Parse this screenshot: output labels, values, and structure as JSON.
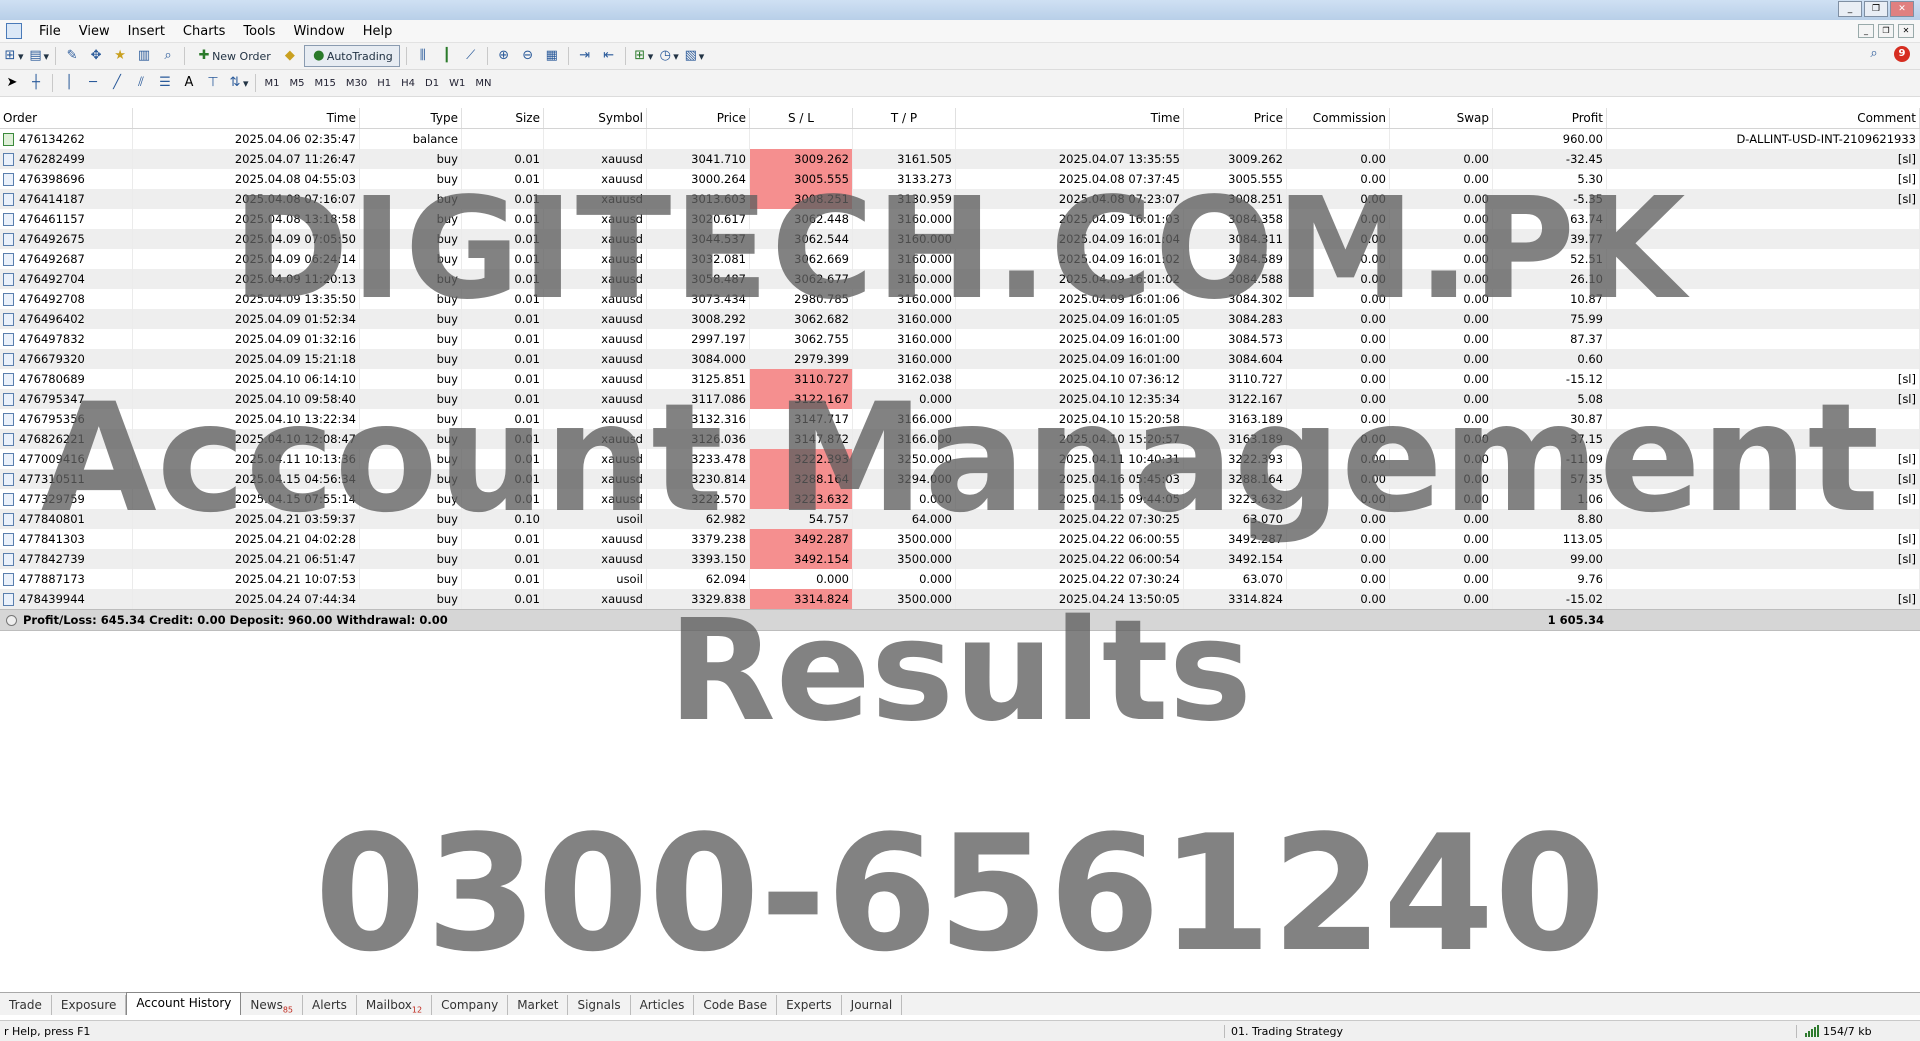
{
  "menu": [
    "File",
    "View",
    "Insert",
    "Charts",
    "Tools",
    "Window",
    "Help"
  ],
  "toolbar": {
    "new_order": "New Order",
    "autotrading": "AutoTrading",
    "notification_count": "9"
  },
  "timeframes": [
    "M1",
    "M5",
    "M15",
    "M30",
    "H1",
    "H4",
    "D1",
    "W1",
    "MN"
  ],
  "columns": {
    "order": "Order",
    "time": "Time",
    "type": "Type",
    "size": "Size",
    "symbol": "Symbol",
    "price": "Price",
    "sl": "S / L",
    "tp": "T / P",
    "close_time": "Time",
    "close_price": "Price",
    "commission": "Commission",
    "swap": "Swap",
    "profit": "Profit",
    "comment": "Comment"
  },
  "rows": [
    {
      "order": "476134262",
      "time": "2025.04.06 02:35:47",
      "type": "balance",
      "size": "",
      "symbol": "",
      "price": "",
      "sl": "",
      "tp": "",
      "close_time": "",
      "close_price": "",
      "commission": "",
      "swap": "",
      "profit": "960.00",
      "comment": "D-ALLINT-USD-INT-2109621933",
      "sl_hit": false
    },
    {
      "order": "476282499",
      "time": "2025.04.07 11:26:47",
      "type": "buy",
      "size": "0.01",
      "symbol": "xauusd",
      "price": "3041.710",
      "sl": "3009.262",
      "tp": "3161.505",
      "close_time": "2025.04.07 13:35:55",
      "close_price": "3009.262",
      "commission": "0.00",
      "swap": "0.00",
      "profit": "-32.45",
      "comment": "[sl]",
      "sl_hit": true
    },
    {
      "order": "476398696",
      "time": "2025.04.08 04:55:03",
      "type": "buy",
      "size": "0.01",
      "symbol": "xauusd",
      "price": "3000.264",
      "sl": "3005.555",
      "tp": "3133.273",
      "close_time": "2025.04.08 07:37:45",
      "close_price": "3005.555",
      "commission": "0.00",
      "swap": "0.00",
      "profit": "5.30",
      "comment": "[sl]",
      "sl_hit": true
    },
    {
      "order": "476414187",
      "time": "2025.04.08 07:16:07",
      "type": "buy",
      "size": "0.01",
      "symbol": "xauusd",
      "price": "3013.603",
      "sl": "3008.251",
      "tp": "3130.959",
      "close_time": "2025.04.08 07:23:07",
      "close_price": "3008.251",
      "commission": "0.00",
      "swap": "0.00",
      "profit": "-5.35",
      "comment": "[sl]",
      "sl_hit": true
    },
    {
      "order": "476461157",
      "time": "2025.04.08 13:18:58",
      "type": "buy",
      "size": "0.01",
      "symbol": "xauusd",
      "price": "3020.617",
      "sl": "3062.448",
      "tp": "3160.000",
      "close_time": "2025.04.09 16:01:03",
      "close_price": "3084.358",
      "commission": "0.00",
      "swap": "0.00",
      "profit": "63.74",
      "comment": "",
      "sl_hit": false
    },
    {
      "order": "476492675",
      "time": "2025.04.09 07:05:50",
      "type": "buy",
      "size": "0.01",
      "symbol": "xauusd",
      "price": "3044.537",
      "sl": "3062.544",
      "tp": "3160.000",
      "close_time": "2025.04.09 16:01:04",
      "close_price": "3084.311",
      "commission": "0.00",
      "swap": "0.00",
      "profit": "39.77",
      "comment": "",
      "sl_hit": false
    },
    {
      "order": "476492687",
      "time": "2025.04.09 06:24:14",
      "type": "buy",
      "size": "0.01",
      "symbol": "xauusd",
      "price": "3032.081",
      "sl": "3062.669",
      "tp": "3160.000",
      "close_time": "2025.04.09 16:01:02",
      "close_price": "3084.589",
      "commission": "0.00",
      "swap": "0.00",
      "profit": "52.51",
      "comment": "",
      "sl_hit": false
    },
    {
      "order": "476492704",
      "time": "2025.04.09 11:20:13",
      "type": "buy",
      "size": "0.01",
      "symbol": "xauusd",
      "price": "3058.487",
      "sl": "3062.677",
      "tp": "3160.000",
      "close_time": "2025.04.09 16:01:02",
      "close_price": "3084.588",
      "commission": "0.00",
      "swap": "0.00",
      "profit": "26.10",
      "comment": "",
      "sl_hit": false
    },
    {
      "order": "476492708",
      "time": "2025.04.09 13:35:50",
      "type": "buy",
      "size": "0.01",
      "symbol": "xauusd",
      "price": "3073.434",
      "sl": "2980.785",
      "tp": "3160.000",
      "close_time": "2025.04.09 16:01:06",
      "close_price": "3084.302",
      "commission": "0.00",
      "swap": "0.00",
      "profit": "10.87",
      "comment": "",
      "sl_hit": false
    },
    {
      "order": "476496402",
      "time": "2025.04.09 01:52:34",
      "type": "buy",
      "size": "0.01",
      "symbol": "xauusd",
      "price": "3008.292",
      "sl": "3062.682",
      "tp": "3160.000",
      "close_time": "2025.04.09 16:01:05",
      "close_price": "3084.283",
      "commission": "0.00",
      "swap": "0.00",
      "profit": "75.99",
      "comment": "",
      "sl_hit": false
    },
    {
      "order": "476497832",
      "time": "2025.04.09 01:32:16",
      "type": "buy",
      "size": "0.01",
      "symbol": "xauusd",
      "price": "2997.197",
      "sl": "3062.755",
      "tp": "3160.000",
      "close_time": "2025.04.09 16:01:00",
      "close_price": "3084.573",
      "commission": "0.00",
      "swap": "0.00",
      "profit": "87.37",
      "comment": "",
      "sl_hit": false
    },
    {
      "order": "476679320",
      "time": "2025.04.09 15:21:18",
      "type": "buy",
      "size": "0.01",
      "symbol": "xauusd",
      "price": "3084.000",
      "sl": "2979.399",
      "tp": "3160.000",
      "close_time": "2025.04.09 16:01:00",
      "close_price": "3084.604",
      "commission": "0.00",
      "swap": "0.00",
      "profit": "0.60",
      "comment": "",
      "sl_hit": false
    },
    {
      "order": "476780689",
      "time": "2025.04.10 06:14:10",
      "type": "buy",
      "size": "0.01",
      "symbol": "xauusd",
      "price": "3125.851",
      "sl": "3110.727",
      "tp": "3162.038",
      "close_time": "2025.04.10 07:36:12",
      "close_price": "3110.727",
      "commission": "0.00",
      "swap": "0.00",
      "profit": "-15.12",
      "comment": "[sl]",
      "sl_hit": true
    },
    {
      "order": "476795347",
      "time": "2025.04.10 09:58:40",
      "type": "buy",
      "size": "0.01",
      "symbol": "xauusd",
      "price": "3117.086",
      "sl": "3122.167",
      "tp": "0.000",
      "close_time": "2025.04.10 12:35:34",
      "close_price": "3122.167",
      "commission": "0.00",
      "swap": "0.00",
      "profit": "5.08",
      "comment": "[sl]",
      "sl_hit": true
    },
    {
      "order": "476795356",
      "time": "2025.04.10 13:22:34",
      "type": "buy",
      "size": "0.01",
      "symbol": "xauusd",
      "price": "3132.316",
      "sl": "3147.717",
      "tp": "3166.000",
      "close_time": "2025.04.10 15:20:58",
      "close_price": "3163.189",
      "commission": "0.00",
      "swap": "0.00",
      "profit": "30.87",
      "comment": "",
      "sl_hit": false
    },
    {
      "order": "476826221",
      "time": "2025.04.10 12:08:47",
      "type": "buy",
      "size": "0.01",
      "symbol": "xauusd",
      "price": "3126.036",
      "sl": "3147.872",
      "tp": "3166.000",
      "close_time": "2025.04.10 15:20:57",
      "close_price": "3163.189",
      "commission": "0.00",
      "swap": "0.00",
      "profit": "37.15",
      "comment": "",
      "sl_hit": false
    },
    {
      "order": "477009416",
      "time": "2025.04.11 10:13:36",
      "type": "buy",
      "size": "0.01",
      "symbol": "xauusd",
      "price": "3233.478",
      "sl": "3222.393",
      "tp": "3250.000",
      "close_time": "2025.04.11 10:40:31",
      "close_price": "3222.393",
      "commission": "0.00",
      "swap": "0.00",
      "profit": "-11.09",
      "comment": "[sl]",
      "sl_hit": true
    },
    {
      "order": "477310511",
      "time": "2025.04.15 04:56:34",
      "type": "buy",
      "size": "0.01",
      "symbol": "xauusd",
      "price": "3230.814",
      "sl": "3288.164",
      "tp": "3294.000",
      "close_time": "2025.04.16 05:45:03",
      "close_price": "3288.164",
      "commission": "0.00",
      "swap": "0.00",
      "profit": "57.35",
      "comment": "[sl]",
      "sl_hit": true
    },
    {
      "order": "477329759",
      "time": "2025.04.15 07:55:14",
      "type": "buy",
      "size": "0.01",
      "symbol": "xauusd",
      "price": "3222.570",
      "sl": "3223.632",
      "tp": "0.000",
      "close_time": "2025.04.15 09:44:05",
      "close_price": "3223.632",
      "commission": "0.00",
      "swap": "0.00",
      "profit": "1.06",
      "comment": "[sl]",
      "sl_hit": true
    },
    {
      "order": "477840801",
      "time": "2025.04.21 03:59:37",
      "type": "buy",
      "size": "0.10",
      "symbol": "usoil",
      "price": "62.982",
      "sl": "54.757",
      "tp": "64.000",
      "close_time": "2025.04.22 07:30:25",
      "close_price": "63.070",
      "commission": "0.00",
      "swap": "0.00",
      "profit": "8.80",
      "comment": "",
      "sl_hit": false
    },
    {
      "order": "477841303",
      "time": "2025.04.21 04:02:28",
      "type": "buy",
      "size": "0.01",
      "symbol": "xauusd",
      "price": "3379.238",
      "sl": "3492.287",
      "tp": "3500.000",
      "close_time": "2025.04.22 06:00:55",
      "close_price": "3492.287",
      "commission": "0.00",
      "swap": "0.00",
      "profit": "113.05",
      "comment": "[sl]",
      "sl_hit": true
    },
    {
      "order": "477842739",
      "time": "2025.04.21 06:51:47",
      "type": "buy",
      "size": "0.01",
      "symbol": "xauusd",
      "price": "3393.150",
      "sl": "3492.154",
      "tp": "3500.000",
      "close_time": "2025.04.22 06:00:54",
      "close_price": "3492.154",
      "commission": "0.00",
      "swap": "0.00",
      "profit": "99.00",
      "comment": "[sl]",
      "sl_hit": true
    },
    {
      "order": "477887173",
      "time": "2025.04.21 10:07:53",
      "type": "buy",
      "size": "0.01",
      "symbol": "usoil",
      "price": "62.094",
      "sl": "0.000",
      "tp": "0.000",
      "close_time": "2025.04.22 07:30:24",
      "close_price": "63.070",
      "commission": "0.00",
      "swap": "0.00",
      "profit": "9.76",
      "comment": "",
      "sl_hit": false
    },
    {
      "order": "478439944",
      "time": "2025.04.24 07:44:34",
      "type": "buy",
      "size": "0.01",
      "symbol": "xauusd",
      "price": "3329.838",
      "sl": "3314.824",
      "tp": "3500.000",
      "close_time": "2025.04.24 13:50:05",
      "close_price": "3314.824",
      "commission": "0.00",
      "swap": "0.00",
      "profit": "-15.02",
      "comment": "[sl]",
      "sl_hit": true
    }
  ],
  "summary": {
    "text": "Profit/Loss: 645.34  Credit: 0.00  Deposit: 960.00  Withdrawal: 0.00",
    "profit": "1 605.34"
  },
  "watermark": {
    "line1": "DIGITECH.COM.PK",
    "line2": "Account Management",
    "line3": "Results",
    "line4": "0300-6561240"
  },
  "tabs": [
    {
      "label": "Trade",
      "badge": ""
    },
    {
      "label": "Exposure",
      "badge": ""
    },
    {
      "label": "Account History",
      "badge": "",
      "active": true
    },
    {
      "label": "News",
      "badge": "85"
    },
    {
      "label": "Alerts",
      "badge": ""
    },
    {
      "label": "Mailbox",
      "badge": "12"
    },
    {
      "label": "Company",
      "badge": ""
    },
    {
      "label": "Market",
      "badge": ""
    },
    {
      "label": "Signals",
      "badge": ""
    },
    {
      "label": "Articles",
      "badge": ""
    },
    {
      "label": "Code Base",
      "badge": ""
    },
    {
      "label": "Experts",
      "badge": ""
    },
    {
      "label": "Journal",
      "badge": ""
    }
  ],
  "status": {
    "help": "r Help, press F1",
    "profile": "01. Trading Strategy",
    "connection": "154/7 kb"
  }
}
